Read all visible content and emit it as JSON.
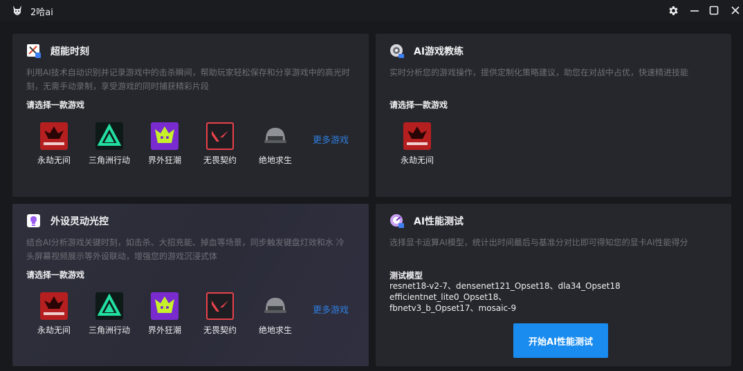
{
  "app": {
    "title": "2哈ai"
  },
  "colors": {
    "accent": "#1a8cf0",
    "link": "#2e7fe0",
    "card_bg": "#26272c",
    "window_bg": "#18191d"
  },
  "window_controls": [
    "gear-icon",
    "minimize-icon",
    "maximize-icon",
    "close-icon"
  ],
  "cards": {
    "highlights": {
      "title": "超能时刻",
      "desc_line1": "利用AI技术自动识别并记录游戏中的击杀瞬间，帮助玩家轻松保存和分享游戏中的高光时",
      "desc_line2": "刻，无需手动录制，享受游戏的同时捕获精彩片段",
      "choose_label": "请选择一款游戏",
      "games": [
        "永劫无间",
        "三角洲行动",
        "界外狂潮",
        "无畏契约",
        "绝地求生"
      ],
      "more": "更多游戏"
    },
    "coach": {
      "title": "AI游戏教练",
      "desc_line1": "实时分析您的游戏操作，提供定制化策略建议，助您在对战中占优，快速精进技能",
      "choose_label": "请选择一款游戏",
      "games": [
        "永劫无间"
      ]
    },
    "lighting": {
      "title": "外设灵动光控",
      "desc_line1": "结合AI分析游戏关键时刻，如击杀、大招充能、掉血等场景，同步触发键盘灯效和水 冷",
      "desc_line2": "头屏幕视频展示等外设联动，增强您的游戏沉浸式体",
      "choose_label": "请选择一款游戏",
      "games": [
        "永劫无间",
        "三角洲行动",
        "界外狂潮",
        "无畏契约",
        "绝地求生"
      ],
      "more": "更多游戏"
    },
    "benchmark": {
      "title": "AI性能测试",
      "desc_line1": "选择显卡运算AI模型，统计出时间最后与基准分对比即可得知您的显卡AI性能得分",
      "model_label": "测试模型",
      "models_line1": "resnet18-v2-7、densenet121_Opset18、dla34_Opset18 efficientnet_lite0_Opset18、",
      "models_line2": "fbnetv3_b_Opset17、mosaic-9",
      "button": "开始AI性能测试"
    }
  }
}
